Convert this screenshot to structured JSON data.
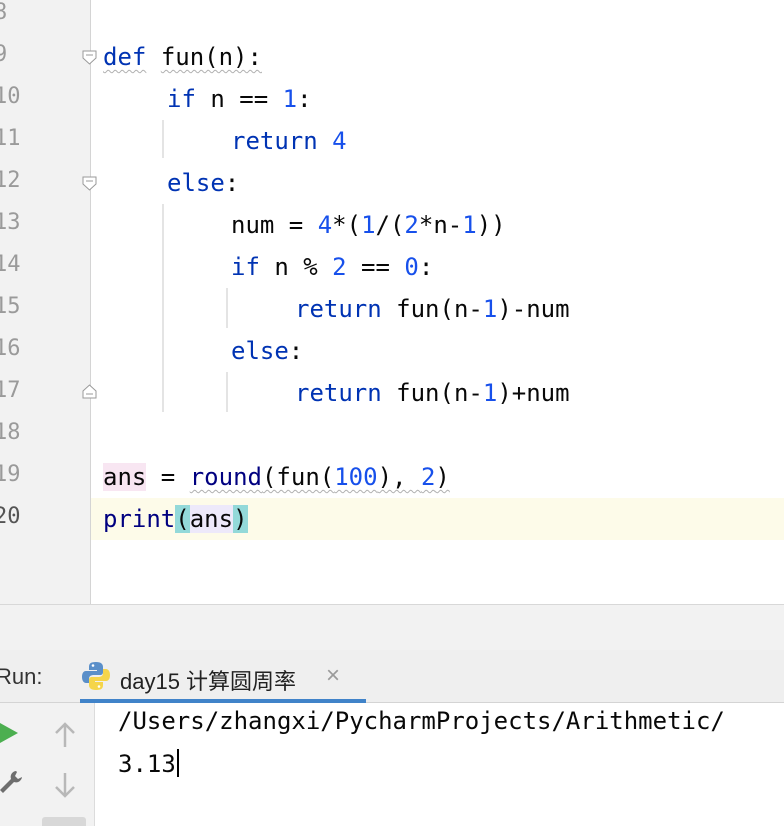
{
  "editor": {
    "line_numbers": [
      "8",
      "9",
      "10",
      "11",
      "12",
      "13",
      "14",
      "15",
      "16",
      "17",
      "18",
      "19",
      "20"
    ],
    "current_line": "20",
    "lines": {
      "l9": {
        "kw": "def",
        "fn_name": "fun(n):"
      },
      "l10": {
        "kw": "if",
        "a": " n == ",
        "num": "1",
        "b": ":"
      },
      "l11": {
        "kw": "return",
        "num": "4"
      },
      "l12": {
        "kw": "else",
        "b": ":"
      },
      "l13": {
        "a": "num = ",
        "n1": "4",
        "b": "*(",
        "n2": "1",
        "c": "/(",
        "n3": "2",
        "d": "*n-",
        "n4": "1",
        "e": "))"
      },
      "l14": {
        "kw": "if",
        "a": " n % ",
        "n1": "2",
        "b": " == ",
        "n2": "0",
        "c": ":"
      },
      "l15": {
        "kw": "return",
        "a": " fun(n-",
        "num": "1",
        "b": ")-num"
      },
      "l16": {
        "kw": "else",
        "b": ":"
      },
      "l17": {
        "kw": "return",
        "a": " fun(n-",
        "num": "1",
        "b": ")+num"
      },
      "l19": {
        "var": "ans",
        "a": " = ",
        "fn": "round",
        "b": "(fun(",
        "n1": "100",
        "c": "), ",
        "n2": "2",
        "d": ")"
      },
      "l20": {
        "fn": "print",
        "p1": "(",
        "arg": "ans",
        "p2": ")"
      }
    }
  },
  "run": {
    "label": "Run:",
    "tab_title": "day15 计算圆周率",
    "close": "×"
  },
  "console": {
    "path": "/Users/zhangxi/PycharmProjects/Arithmetic/",
    "output": "3.13"
  },
  "icons": [
    "fold-icon",
    "python-icon",
    "run-icon",
    "wrench-icon",
    "arrow-up-icon",
    "arrow-down-icon",
    "close-icon"
  ],
  "colors": {
    "keyword": "#0033b3",
    "number": "#1750eb",
    "builtin": "#000080",
    "run_green": "#4caf50",
    "tab_accent": "#4083c9"
  }
}
